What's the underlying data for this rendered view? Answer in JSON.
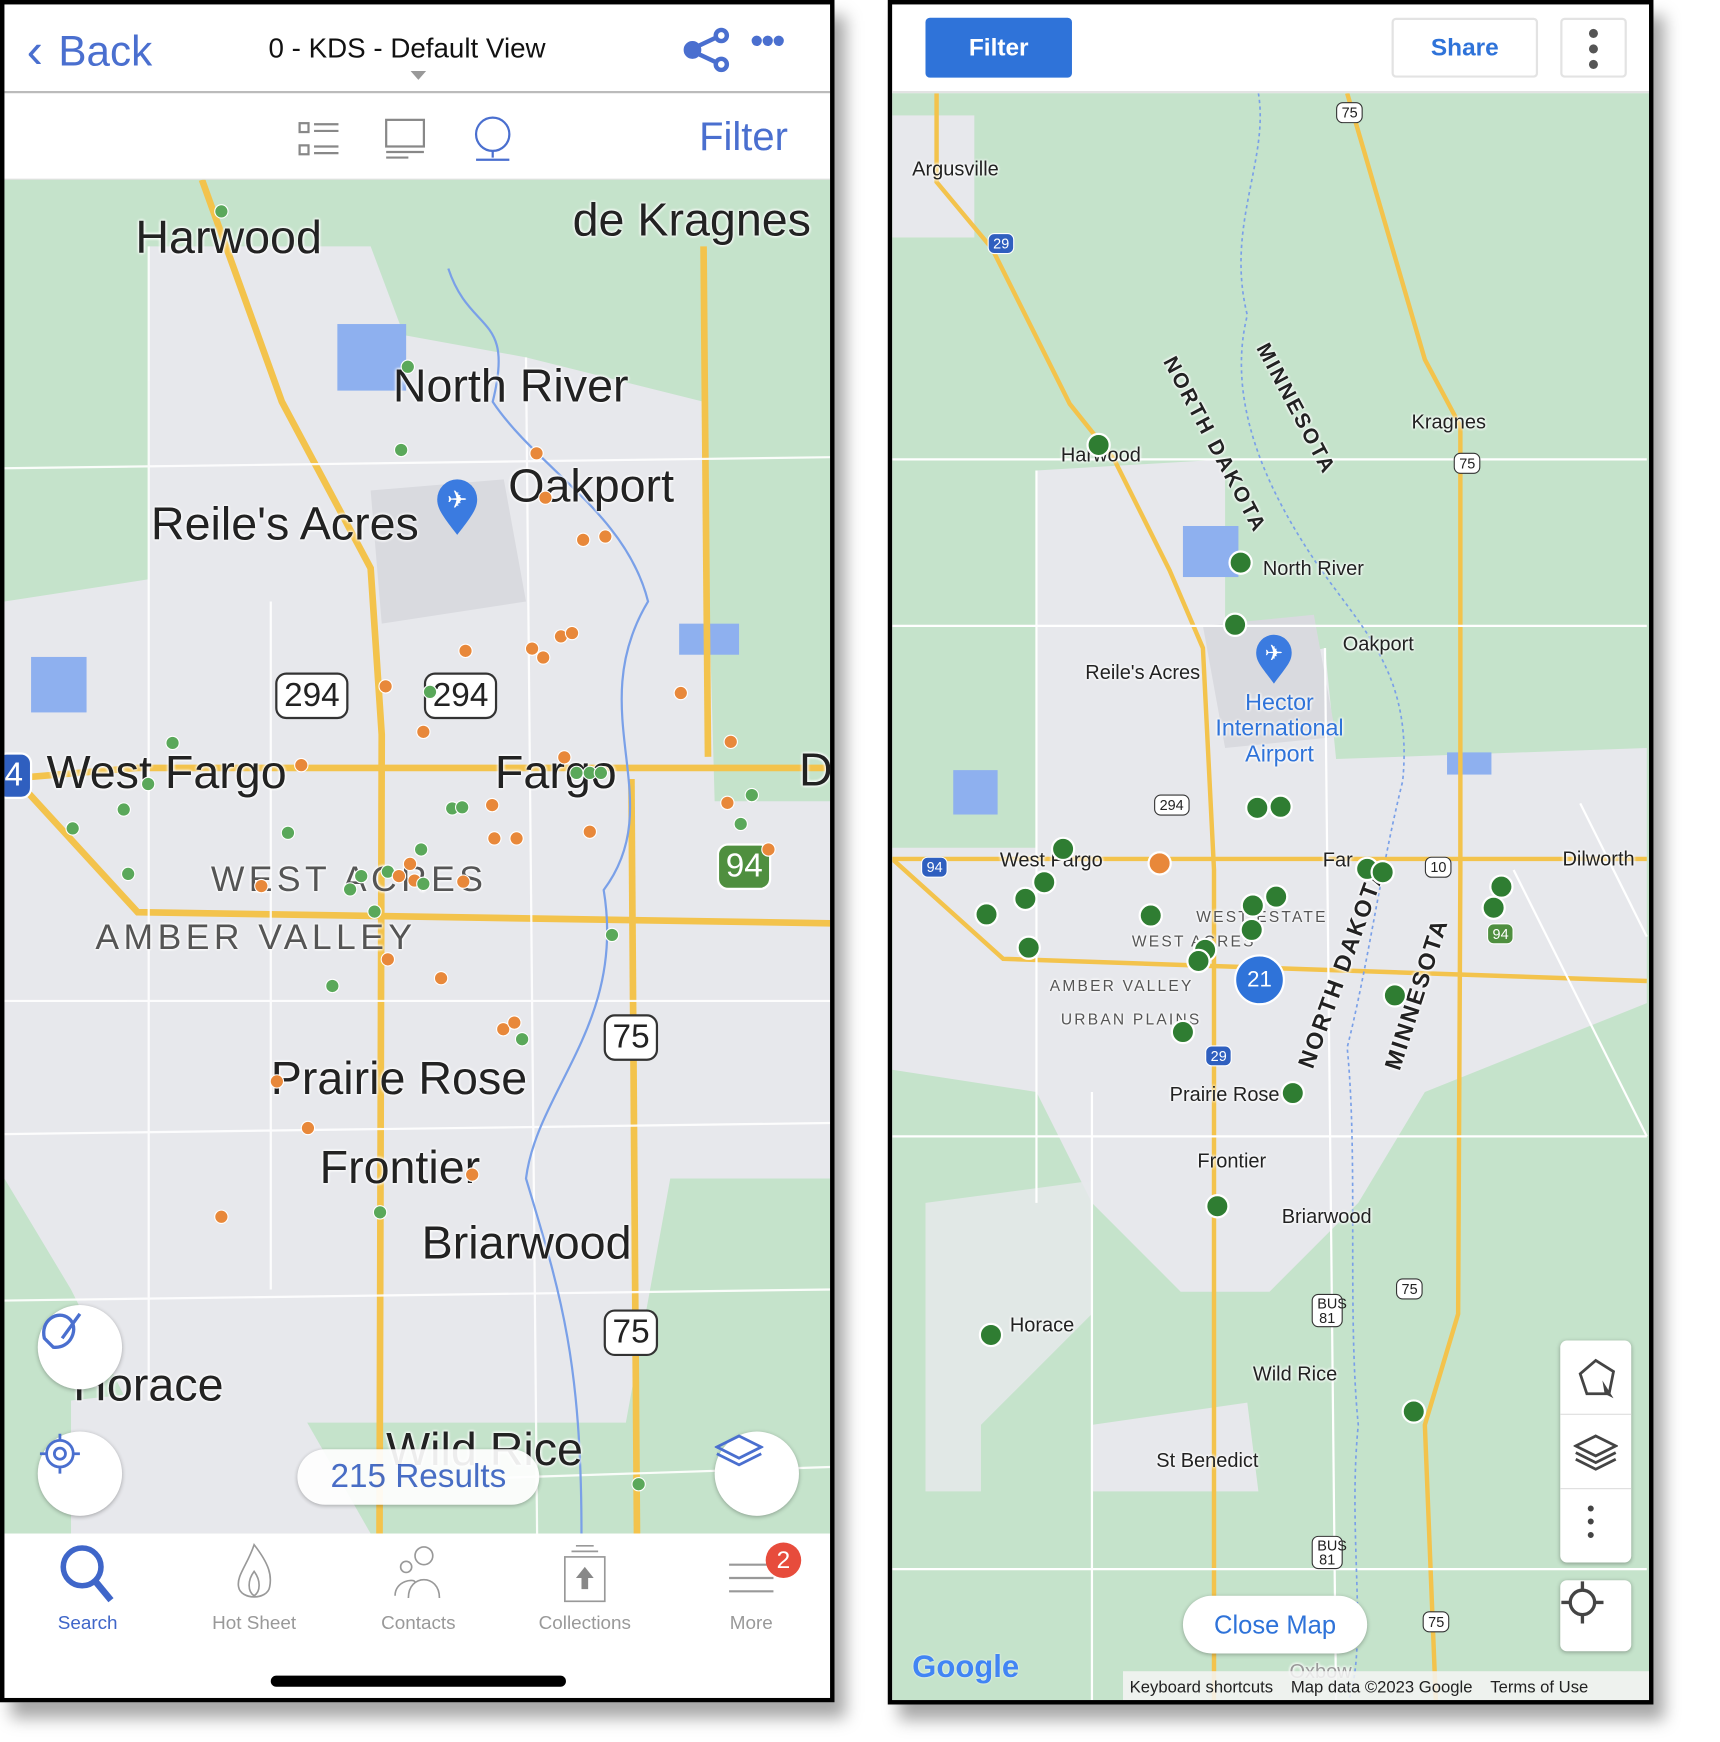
{
  "left": {
    "header": {
      "back_label": "Back",
      "title": "0 - KDS - Default View",
      "filter_label": "Filter"
    },
    "map_labels": [
      "Harwood",
      "de Kragnes",
      "North River",
      "Oakport",
      "Reile's Acres",
      "West Fargo",
      "Fargo",
      "D",
      "WEST ACRES",
      "AMBER VALLEY",
      "Prairie Rose",
      "Frontier",
      "Briarwood",
      "Horace",
      "Wild Rice"
    ],
    "shields": [
      "294",
      "294",
      "94",
      "75",
      "75",
      "4"
    ],
    "results_label": "215 Results",
    "tabs": [
      {
        "label": "Search",
        "icon": "search-icon",
        "active": true
      },
      {
        "label": "Hot Sheet",
        "icon": "flame-icon"
      },
      {
        "label": "Contacts",
        "icon": "contacts-icon"
      },
      {
        "label": "Collections",
        "icon": "collections-icon"
      },
      {
        "label": "More",
        "icon": "menu-icon",
        "badge": "2"
      }
    ],
    "marker_colors": {
      "orange": "#e8883a",
      "green": "#5aa85a"
    }
  },
  "right": {
    "header": {
      "filter_label": "Filter",
      "share_label": "Share"
    },
    "map_labels": [
      "Argusville",
      "Harwood",
      "NORTH DAKOTA",
      "MINNESOTA",
      "Kragnes",
      "North River",
      "Oakport",
      "Reile's Acres",
      "Hector International Airport",
      "West Fargo",
      "Far",
      "Dilworth",
      "WEST ACRES",
      "WEST ESTATE",
      "AMBER VALLEY",
      "URBAN PLAINS",
      "NORTH DAKOTA",
      "MINNESOTA",
      "Prairie Rose",
      "Frontier",
      "Briarwood",
      "Horace",
      "Wild Rice",
      "St Benedict",
      "Oxbow"
    ],
    "shields": [
      "75",
      "29",
      "75",
      "294",
      "94",
      "10",
      "94",
      "29",
      "75",
      "BUS 81",
      "BUS 81",
      "75"
    ],
    "cluster_count": "21",
    "close_map_label": "Close Map",
    "attribution": {
      "shortcuts": "Keyboard shortcuts",
      "map_data": "Map data ©2023 Google",
      "terms": "Terms of Use"
    },
    "google_logo": "Google",
    "accent": "#2f73d9"
  }
}
